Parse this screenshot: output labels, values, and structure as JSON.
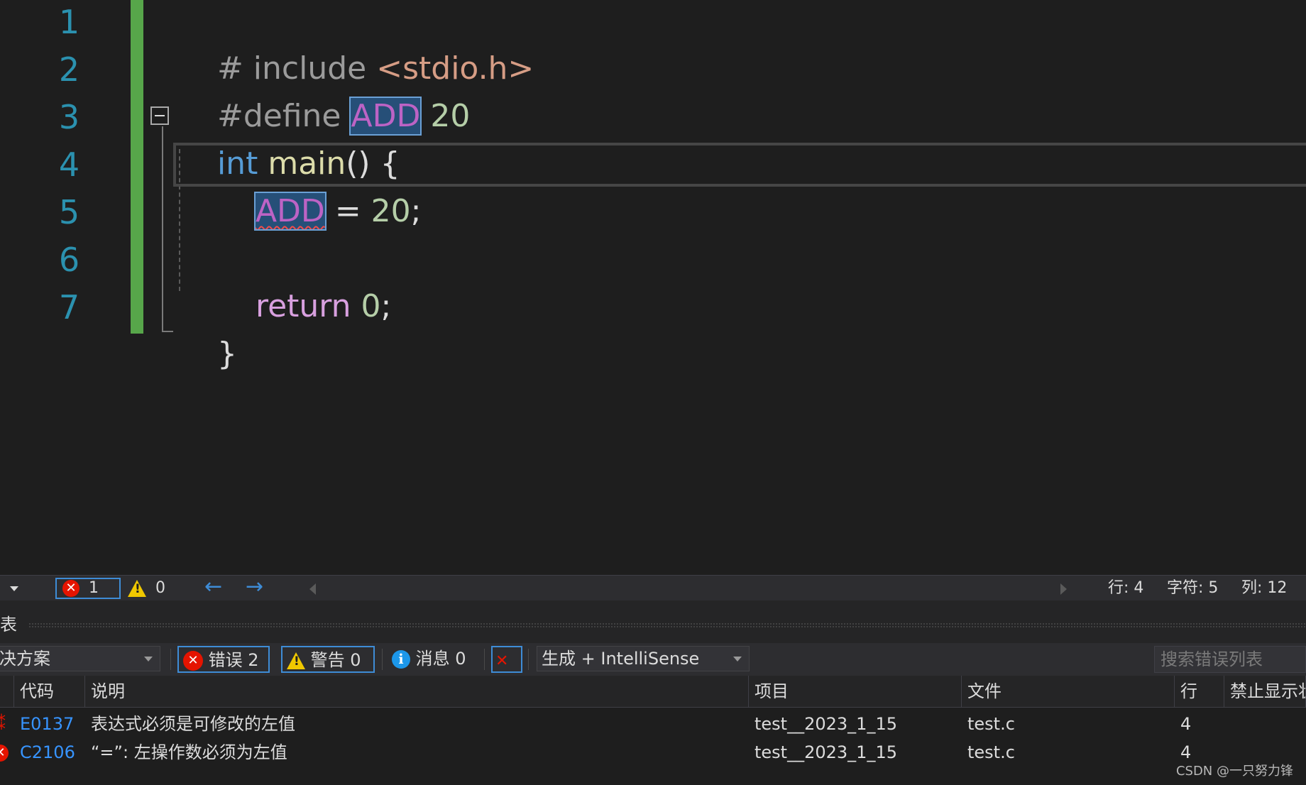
{
  "editor": {
    "line_numbers": [
      "1",
      "2",
      "3",
      "4",
      "5",
      "6",
      "7"
    ],
    "lines": {
      "l1": {
        "hash_include": "# include ",
        "header": "<stdio.h>"
      },
      "l2": {
        "define": "#define ",
        "macro": "ADD",
        "value": " 20"
      },
      "l3": {
        "type": "int",
        "space": " ",
        "func": "main",
        "rest": "() {"
      },
      "l4": {
        "macro": "ADD",
        "rest_op": " = ",
        "num": "20",
        "semi": ";"
      },
      "l6": {
        "kw": "return",
        "space": " ",
        "num": "0",
        "semi": ";"
      },
      "l7": {
        "brace": "}"
      }
    }
  },
  "status_strip": {
    "error_count": "1",
    "warning_count": "0",
    "back_arrow": "←",
    "forward_arrow": "→",
    "line": "行: 4",
    "char": "字符: 5",
    "col": "列: 12"
  },
  "error_list": {
    "title": "表",
    "scope": "决方案",
    "errors_btn": "错误 2",
    "warnings_btn": "警告 0",
    "messages_btn": "消息 0",
    "build_filter": "生成 + IntelliSense",
    "search_placeholder": "搜索错误列表",
    "columns": [
      "代码",
      "说明",
      "项目",
      "文件",
      "行",
      "禁止显示状"
    ],
    "rows": [
      {
        "code": "E0137",
        "desc": "表达式必须是可修改的左值",
        "project": "test__2023_1_15",
        "file": "test.c",
        "line": "4",
        "suppress": ""
      },
      {
        "code": "C2106",
        "desc": "“=”: 左操作数必须为左值",
        "project": "test__2023_1_15",
        "file": "test.c",
        "line": "4",
        "suppress": ""
      }
    ]
  },
  "watermark": "CSDN @一只努力锋",
  "colors": {
    "background": "#1e1e1e",
    "line_number": "#2b91af",
    "change_bar": "#57a64a",
    "error_red": "#e51400",
    "warning_yellow": "#f0c800",
    "link_blue": "#3794ff"
  }
}
